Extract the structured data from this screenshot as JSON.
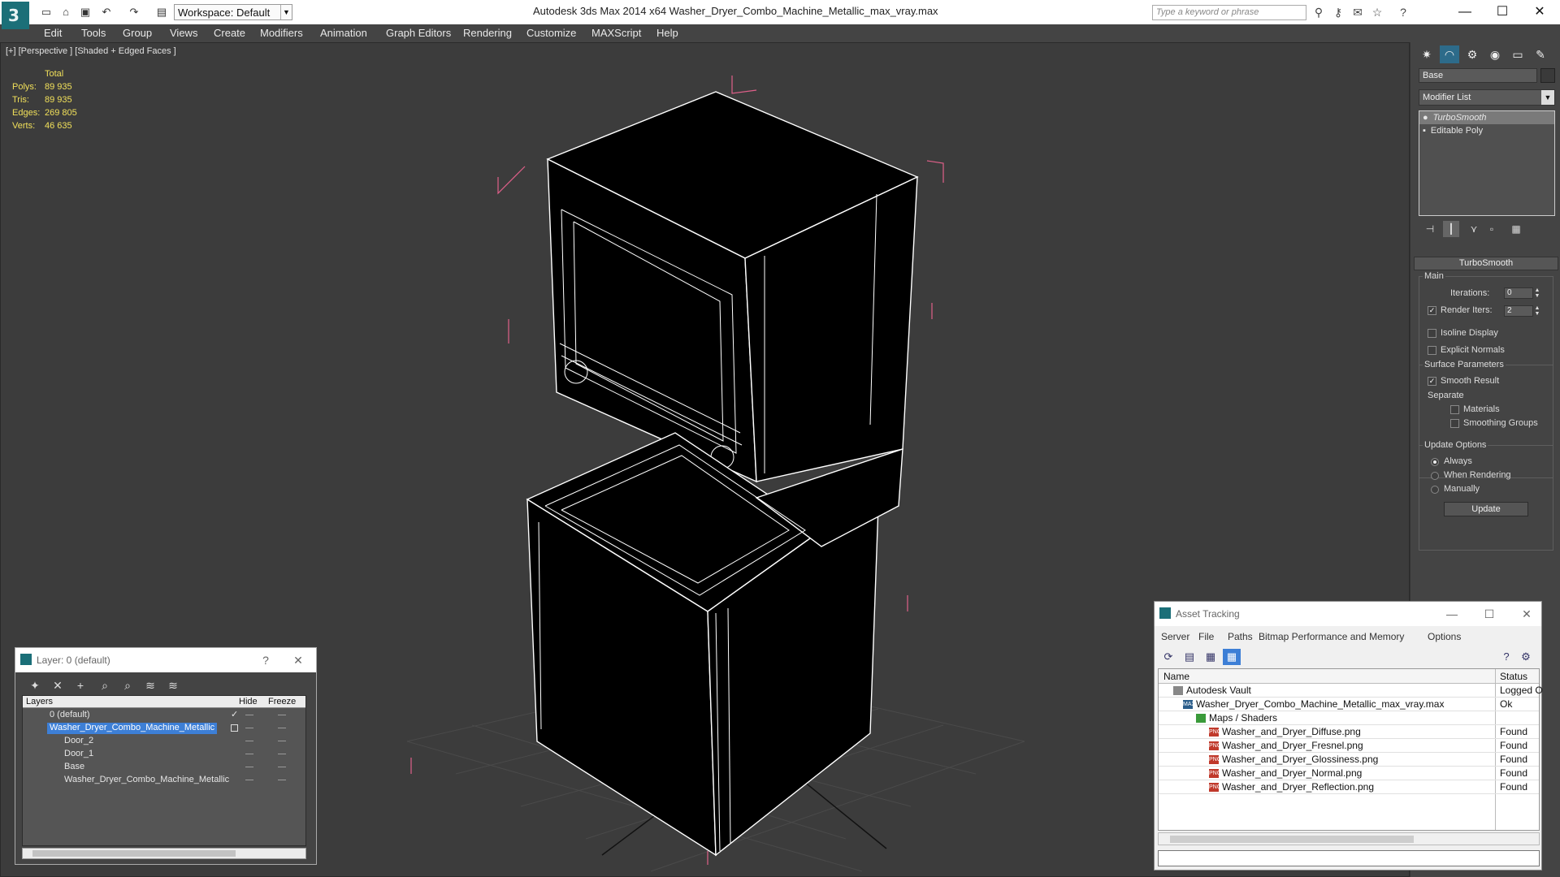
{
  "titlebar": {
    "workspace": "Workspace: Default",
    "title": "Autodesk 3ds Max  2014 x64      Washer_Dryer_Combo_Machine_Metallic_max_vray.max",
    "search_placeholder": "Type a keyword or phrase"
  },
  "menu": [
    "Edit",
    "Tools",
    "Group",
    "Views",
    "Create",
    "Modifiers",
    "Animation",
    "Graph Editors",
    "Rendering",
    "Customize",
    "MAXScript",
    "Help"
  ],
  "viewport": {
    "label": "[+] [Perspective ] [Shaded + Edged Faces ]",
    "stats": {
      "header": "Total",
      "rows": [
        {
          "k": "Polys:",
          "v": "89 935"
        },
        {
          "k": "Tris:",
          "v": "89 935"
        },
        {
          "k": "Edges:",
          "v": "269 805"
        },
        {
          "k": "Verts:",
          "v": "46 635"
        }
      ]
    }
  },
  "command_panel": {
    "object_name": "Base",
    "modifier_list": "Modifier List",
    "stack": [
      "TurboSmooth",
      "Editable Poly"
    ],
    "rollout": "TurboSmooth",
    "main_group": "Main",
    "iterations_label": "Iterations:",
    "iterations_value": "0",
    "render_iters_label": "Render Iters:",
    "render_iters_value": "2",
    "isoline": "Isoline Display",
    "explicit": "Explicit Normals",
    "surface_group": "Surface Parameters",
    "smooth_result": "Smooth Result",
    "separate": "Separate",
    "materials": "Materials",
    "smoothing_groups": "Smoothing Groups",
    "update_group": "Update Options",
    "always": "Always",
    "when_rendering": "When Rendering",
    "manually": "Manually",
    "update_btn": "Update"
  },
  "layer_window": {
    "title": "Layer: 0 (default)",
    "help": "?",
    "cols": {
      "layers": "Layers",
      "hide": "Hide",
      "freeze": "Freeze"
    },
    "rows": [
      {
        "name": "0 (default)"
      },
      {
        "name": "Washer_Dryer_Combo_Machine_Metallic"
      },
      {
        "name": "Door_2"
      },
      {
        "name": "Door_1"
      },
      {
        "name": "Base"
      },
      {
        "name": "Washer_Dryer_Combo_Machine_Metallic"
      }
    ]
  },
  "asset_window": {
    "title": "Asset Tracking",
    "menu": [
      "Server",
      "File",
      "Paths",
      "Bitmap Performance and Memory",
      "Options"
    ],
    "cols": {
      "name": "Name",
      "status": "Status"
    },
    "rows": [
      {
        "name": "Autodesk Vault",
        "status": "Logged O"
      },
      {
        "name": "Washer_Dryer_Combo_Machine_Metallic_max_vray.max",
        "status": "Ok"
      },
      {
        "name": "Maps / Shaders",
        "status": ""
      },
      {
        "name": "Washer_and_Dryer_Diffuse.png",
        "status": "Found"
      },
      {
        "name": "Washer_and_Dryer_Fresnel.png",
        "status": "Found"
      },
      {
        "name": "Washer_and_Dryer_Glossiness.png",
        "status": "Found"
      },
      {
        "name": "Washer_and_Dryer_Normal.png",
        "status": "Found"
      },
      {
        "name": "Washer_and_Dryer_Reflection.png",
        "status": "Found"
      }
    ]
  }
}
